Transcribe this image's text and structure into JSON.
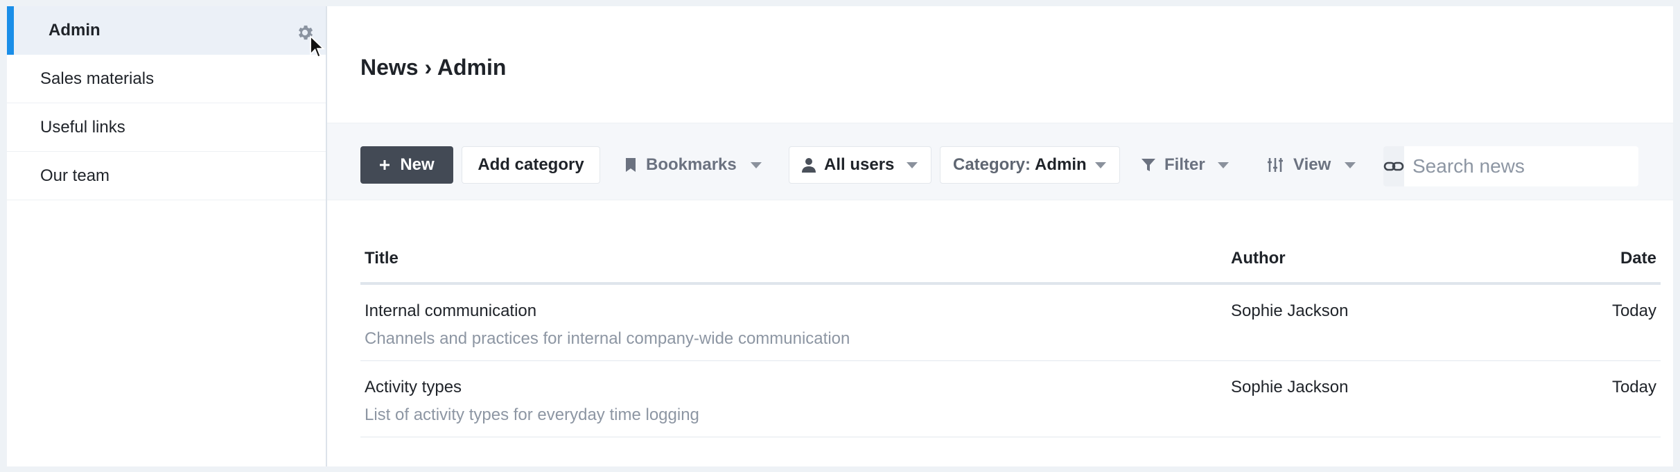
{
  "sidebar": {
    "items": [
      {
        "label": "Admin"
      },
      {
        "label": "Sales materials"
      },
      {
        "label": "Useful links"
      },
      {
        "label": "Our team"
      }
    ]
  },
  "breadcrumb": "News › Admin",
  "toolbar": {
    "new_label": "New",
    "new_icon": "plus",
    "add_category_label": "Add category",
    "bookmarks_label": "Bookmarks",
    "all_users_label": "All users",
    "category_prefix": "Category:",
    "category_value": "Admin",
    "filter_label": "Filter",
    "view_label": "View",
    "search_placeholder": "Search news"
  },
  "table": {
    "headers": {
      "title": "Title",
      "author": "Author",
      "date": "Date"
    },
    "rows": [
      {
        "title": "Internal communication",
        "subtitle": "Channels and practices for internal company-wide communication",
        "author": "Sophie Jackson",
        "date": "Today"
      },
      {
        "title": "Activity types",
        "subtitle": "List of activity types for everyday time logging",
        "author": "Sophie Jackson",
        "date": "Today"
      }
    ]
  },
  "colors": {
    "accent": "#1a8ee8",
    "primary_button": "#434a55",
    "active_sidebar_bg": "#ebf0f7"
  }
}
